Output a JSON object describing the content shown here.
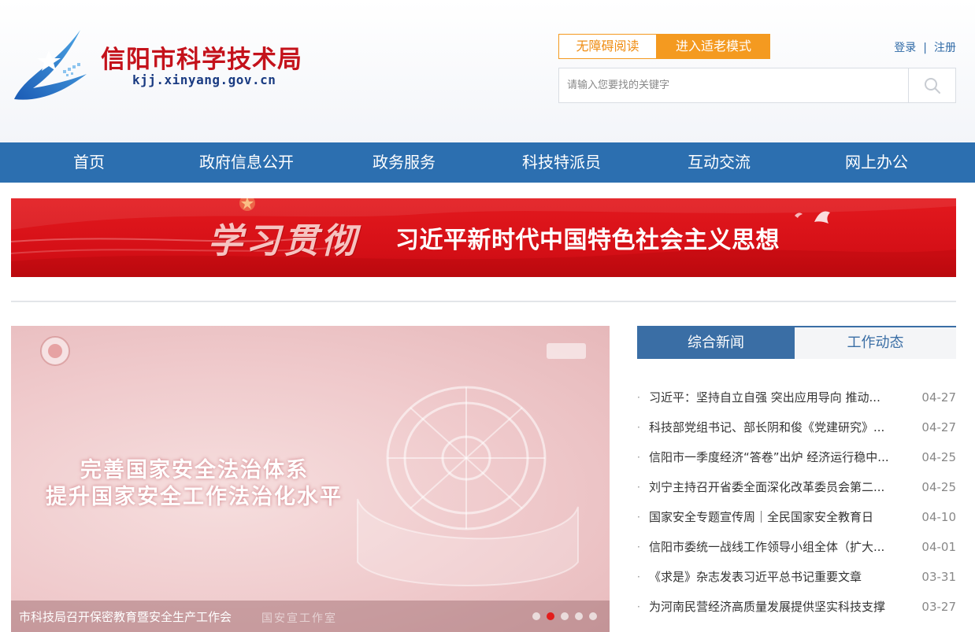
{
  "header": {
    "site_name": "信阳市科学技术局",
    "site_domain": "kjj.xinyang.gov.cn",
    "accessible_reading_label": "无障碍阅读",
    "elder_mode_label": "进入适老模式",
    "login_label": "登录",
    "auth_separator": "|",
    "register_label": "注册",
    "search_placeholder": "请输入您要找的关键字",
    "colors": {
      "brand_red": "#c4121b",
      "accent_orange": "#f49a20",
      "nav_blue": "#2c6fb0"
    }
  },
  "nav": {
    "items": [
      {
        "label": "首页"
      },
      {
        "label": "政府信息公开"
      },
      {
        "label": "政务服务"
      },
      {
        "label": "科技特派员"
      },
      {
        "label": "互动交流"
      },
      {
        "label": "网上办公"
      }
    ]
  },
  "banner": {
    "calligraphy": "学习贯彻",
    "text": "习近平新时代中国特色社会主义思想"
  },
  "carousel": {
    "slide_line1": "完善国家安全法治体系",
    "slide_line2": "提升国家安全工作法治化水平",
    "caption": "市科技局召开保密教育暨安全生产工作会",
    "watermark": "国安宣工作室",
    "dots": 5,
    "active_dot": 2
  },
  "news": {
    "tabs": [
      {
        "label": "综合新闻",
        "active": true
      },
      {
        "label": "工作动态",
        "active": false
      }
    ],
    "items": [
      {
        "title": "习近平：坚持自立自强 突出应用导向 推动我国科技事业加快发展",
        "date": "04-27"
      },
      {
        "title": "科技部党组书记、部长阴和俊《党建研究》发表署名文章",
        "date": "04-27"
      },
      {
        "title": "信阳市一季度经济“答卷”出炉 经济运行稳中有进",
        "date": "04-25"
      },
      {
        "title": "刘宁主持召开省委全面深化改革委员会第二次会议",
        "date": "04-25"
      },
      {
        "title": "国家安全专题宣传周｜全民国家安全教育日",
        "date": "04-10"
      },
      {
        "title": "信阳市委统一战线工作领导小组全体（扩大）会议召开",
        "date": "04-01"
      },
      {
        "title": "《求是》杂志发表习近平总书记重要文章",
        "date": "03-31"
      },
      {
        "title": "为河南民营经济高质量发展提供坚实科技支撑",
        "date": "03-27"
      }
    ]
  }
}
